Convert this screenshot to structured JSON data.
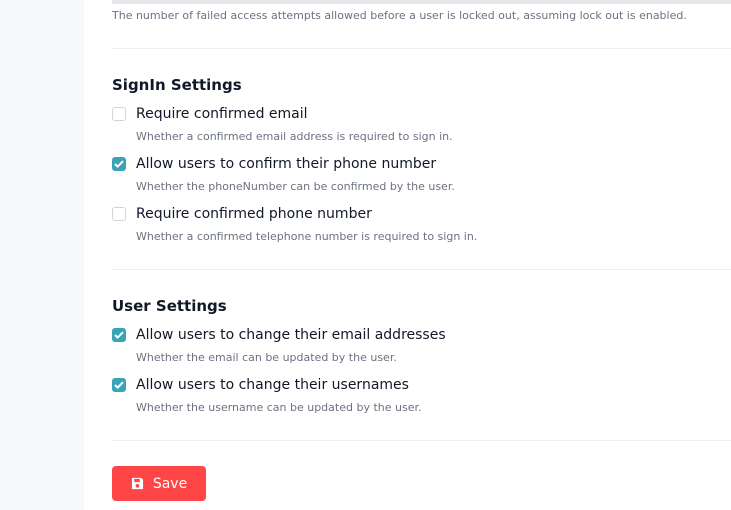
{
  "lockout": {
    "description": "The number of failed access attempts allowed before a user is locked out, assuming lock out is enabled."
  },
  "signin": {
    "title": "SignIn Settings",
    "options": [
      {
        "label": "Require confirmed email",
        "hint": "Whether a confirmed email address is required to sign in.",
        "checked": false
      },
      {
        "label": "Allow users to confirm their phone number",
        "hint": "Whether the phoneNumber can be confirmed by the user.",
        "checked": true
      },
      {
        "label": "Require confirmed phone number",
        "hint": "Whether a confirmed telephone number is required to sign in.",
        "checked": false
      }
    ]
  },
  "user": {
    "title": "User Settings",
    "options": [
      {
        "label": "Allow users to change their email addresses",
        "hint": "Whether the email can be updated by the user.",
        "checked": true
      },
      {
        "label": "Allow users to change their usernames",
        "hint": "Whether the username can be updated by the user.",
        "checked": true
      }
    ]
  },
  "actions": {
    "save_label": "Save",
    "save_icon": "save-icon"
  },
  "colors": {
    "accent": "#3aa3b5",
    "save_button": "#ff4646"
  }
}
